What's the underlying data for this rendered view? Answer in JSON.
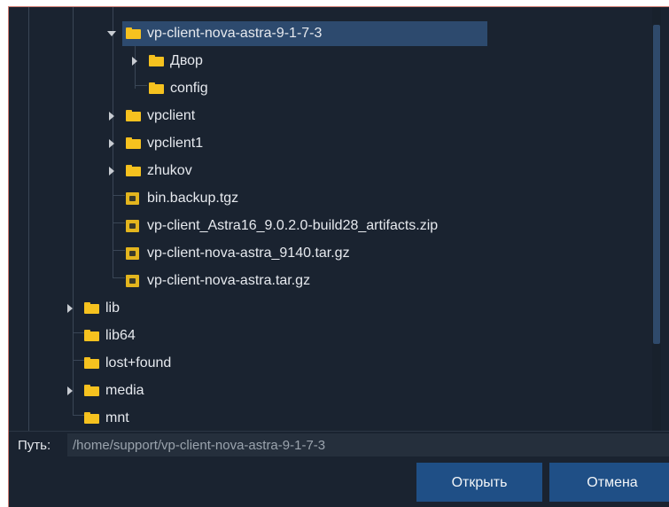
{
  "tree": {
    "rows": [
      {
        "label": "vp-client-nova-astra-9-1-7-3",
        "icon": "folder-icon",
        "expander": "down",
        "level": 2,
        "selected": true
      },
      {
        "label": "Двор",
        "icon": "folder-icon",
        "expander": "right",
        "level": 3
      },
      {
        "label": "config",
        "icon": "folder-icon",
        "expander": "none",
        "level": 3
      },
      {
        "label": "vpclient",
        "icon": "folder-icon",
        "expander": "right",
        "level": 2
      },
      {
        "label": "vpclient1",
        "icon": "folder-icon",
        "expander": "right",
        "level": 2
      },
      {
        "label": "zhukov",
        "icon": "folder-icon",
        "expander": "right",
        "level": 2
      },
      {
        "label": "bin.backup.tgz",
        "icon": "archive-icon",
        "expander": "none",
        "level": 2
      },
      {
        "label": "vp-client_Astra16_9.0.2.0-build28_artifacts.zip",
        "icon": "archive-icon",
        "expander": "none",
        "level": 2
      },
      {
        "label": "vp-client-nova-astra_9140.tar.gz",
        "icon": "archive-icon",
        "expander": "none",
        "level": 2
      },
      {
        "label": "vp-client-nova-astra.tar.gz",
        "icon": "archive-icon",
        "expander": "none",
        "level": 2
      },
      {
        "label": "lib",
        "icon": "folder-icon",
        "expander": "right",
        "level": 1
      },
      {
        "label": "lib64",
        "icon": "folder-icon",
        "expander": "none",
        "level": 1
      },
      {
        "label": "lost+found",
        "icon": "folder-icon",
        "expander": "none",
        "level": 1
      },
      {
        "label": "media",
        "icon": "folder-icon",
        "expander": "right",
        "level": 1
      },
      {
        "label": "mnt",
        "icon": "folder-icon",
        "expander": "none",
        "level": 1
      }
    ]
  },
  "path": {
    "label": "Путь:",
    "value": "/home/support/vp-client-nova-astra-9-1-7-3"
  },
  "buttons": {
    "open": "Открыть",
    "cancel": "Отмена"
  },
  "colors": {
    "background": "#1a2330",
    "selection": "#2d4a6e",
    "folder": "#f6c21f",
    "button": "#1f4f86"
  }
}
